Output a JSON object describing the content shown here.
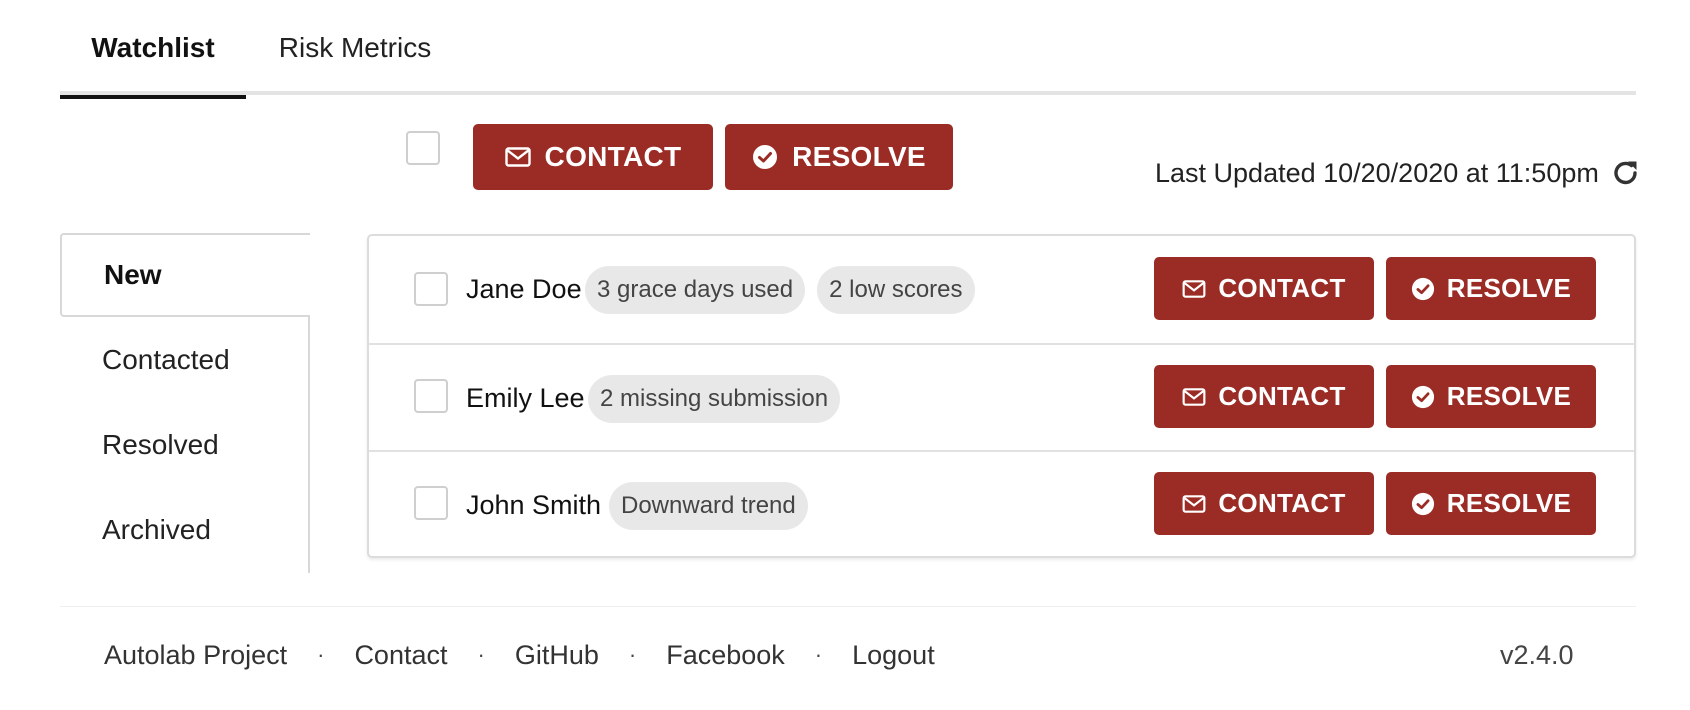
{
  "tabs": [
    {
      "label": "Watchlist",
      "active": true
    },
    {
      "label": "Risk Metrics",
      "active": false
    }
  ],
  "toolbar": {
    "contact_label": "CONTACT",
    "resolve_label": "RESOLVE",
    "contact_icon": "envelope-icon",
    "resolve_icon": "check-circle-icon",
    "last_updated": "Last Updated 10/20/2020 at 11:50pm",
    "refresh_icon": "refresh-icon"
  },
  "sidebar": {
    "items": [
      {
        "label": "New",
        "active": true
      },
      {
        "label": "Contacted",
        "active": false
      },
      {
        "label": "Resolved",
        "active": false
      },
      {
        "label": "Archived",
        "active": false
      }
    ]
  },
  "students": [
    {
      "name": "Jane Doe",
      "tags": [
        "3 grace days used",
        "2 low scores"
      ],
      "contact_label": "CONTACT",
      "resolve_label": "RESOLVE"
    },
    {
      "name": "Emily Lee",
      "tags": [
        "2 missing submission"
      ],
      "contact_label": "CONTACT",
      "resolve_label": "RESOLVE"
    },
    {
      "name": "John Smith",
      "tags": [
        "Downward trend"
      ],
      "contact_label": "CONTACT",
      "resolve_label": "RESOLVE"
    }
  ],
  "footer": {
    "links": [
      "Autolab Project",
      "Contact",
      "GitHub",
      "Facebook",
      "Logout"
    ],
    "separator": "·",
    "version": "v2.4.0"
  },
  "colors": {
    "accent": "#9b2c25",
    "tag_bg": "#e8e8e8",
    "border": "#dcdcdc"
  }
}
